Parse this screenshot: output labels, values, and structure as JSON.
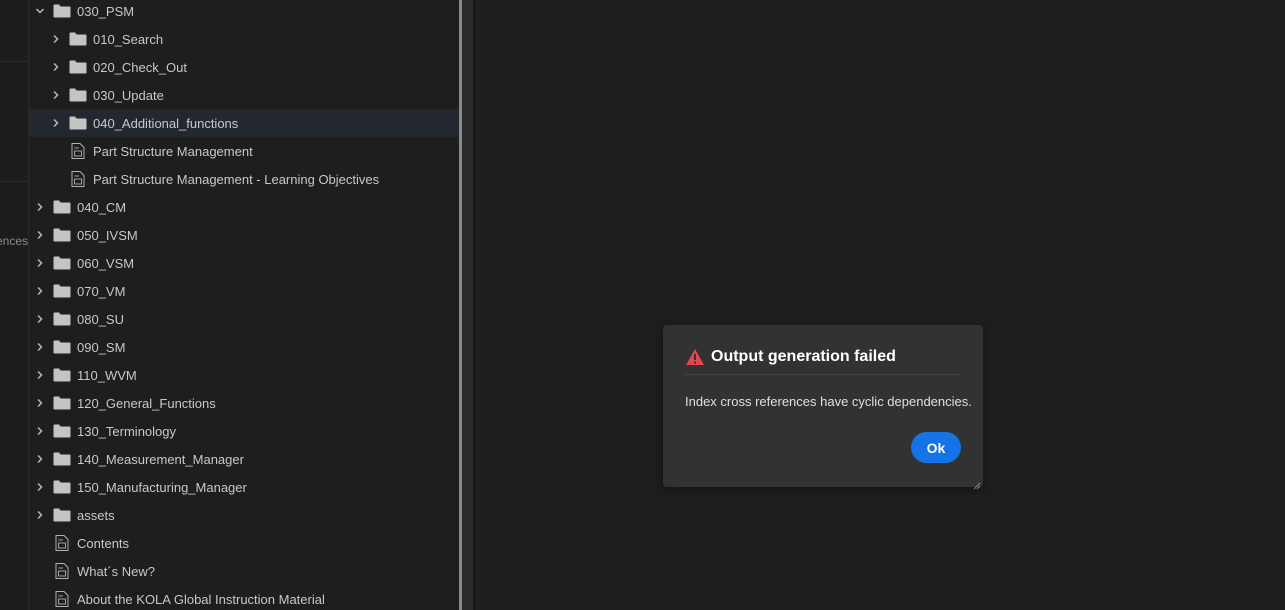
{
  "left_strip": {
    "partial_label": "References"
  },
  "tree": {
    "rows": [
      {
        "label": "030_PSM",
        "type": "folder",
        "expanded": true,
        "level": 0
      },
      {
        "label": "010_Search",
        "type": "folder",
        "expanded": false,
        "level": 1
      },
      {
        "label": "020_Check_Out",
        "type": "folder",
        "expanded": false,
        "level": 1
      },
      {
        "label": "030_Update",
        "type": "folder",
        "expanded": false,
        "level": 1
      },
      {
        "label": "040_Additional_functions",
        "type": "folder",
        "expanded": false,
        "level": 1,
        "selected": true
      },
      {
        "label": "Part Structure Management",
        "type": "file",
        "level": 1
      },
      {
        "label": "Part Structure Management - Learning Objectives",
        "type": "file",
        "level": 1
      },
      {
        "label": "040_CM",
        "type": "folder",
        "expanded": false,
        "level": 0
      },
      {
        "label": "050_IVSM",
        "type": "folder",
        "expanded": false,
        "level": 0
      },
      {
        "label": "060_VSM",
        "type": "folder",
        "expanded": false,
        "level": 0
      },
      {
        "label": "070_VM",
        "type": "folder",
        "expanded": false,
        "level": 0
      },
      {
        "label": "080_SU",
        "type": "folder",
        "expanded": false,
        "level": 0
      },
      {
        "label": "090_SM",
        "type": "folder",
        "expanded": false,
        "level": 0
      },
      {
        "label": "110_WVM",
        "type": "folder",
        "expanded": false,
        "level": 0
      },
      {
        "label": "120_General_Functions",
        "type": "folder",
        "expanded": false,
        "level": 0
      },
      {
        "label": "130_Terminology",
        "type": "folder",
        "expanded": false,
        "level": 0
      },
      {
        "label": "140_Measurement_Manager",
        "type": "folder",
        "expanded": false,
        "level": 0
      },
      {
        "label": "150_Manufacturing_Manager",
        "type": "folder",
        "expanded": false,
        "level": 0
      },
      {
        "label": "assets",
        "type": "folder",
        "expanded": false,
        "level": 0
      },
      {
        "label": "Contents",
        "type": "file",
        "level": 0
      },
      {
        "label": "What´s New?",
        "type": "file",
        "level": 0
      },
      {
        "label": "About the KOLA Global Instruction Material",
        "type": "file",
        "level": 0
      }
    ]
  },
  "dialog": {
    "title": "Output generation failed",
    "message": "Index cross references have cyclic dependencies.",
    "ok_label": "Ok",
    "icon": "alert-triangle-icon"
  },
  "colors": {
    "background": "#1e1e1e",
    "dialog_bg": "#323232",
    "accent": "#1473e6",
    "alert": "#e34850",
    "text": "#c8c8c8"
  }
}
